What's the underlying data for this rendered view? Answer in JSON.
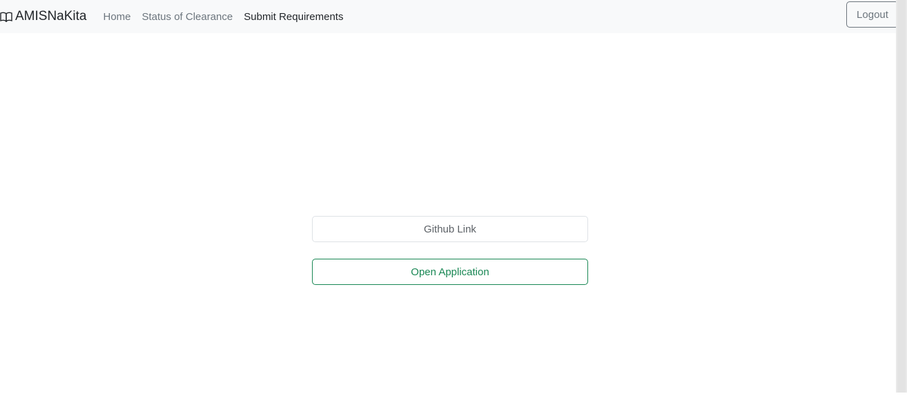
{
  "navbar": {
    "brand": {
      "icon": "book-icon",
      "label": "AMISNaKita"
    },
    "links": [
      {
        "label": "Home",
        "active": false
      },
      {
        "label": "Status of Clearance",
        "active": false
      },
      {
        "label": "Submit Requirements",
        "active": true
      }
    ],
    "logout_label": "Logout"
  },
  "form": {
    "github_input": {
      "placeholder": "Github Link",
      "value": ""
    },
    "open_button_label": "Open Application"
  },
  "colors": {
    "navbar_bg": "#f8f9fa",
    "link_muted": "#6c757d",
    "link_active": "#212529",
    "success": "#198754",
    "input_border": "#dee2e6"
  }
}
